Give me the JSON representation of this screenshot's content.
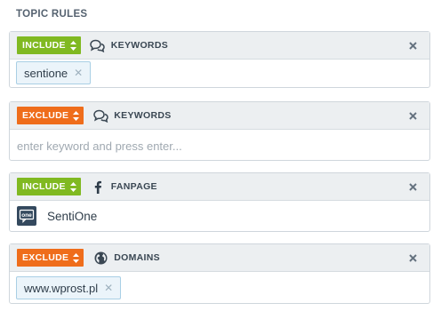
{
  "section_title": "TOPIC RULES",
  "rules": [
    {
      "type_label": "INCLUDE",
      "type": "include",
      "icon": "speech-bubbles-icon",
      "label": "KEYWORDS",
      "tags": [
        "sentione"
      ]
    },
    {
      "type_label": "EXCLUDE",
      "type": "exclude",
      "icon": "speech-bubbles-icon",
      "label": "KEYWORDS",
      "input_placeholder": "enter keyword and press enter..."
    },
    {
      "type_label": "INCLUDE",
      "type": "include",
      "icon": "facebook-icon",
      "label": "FANPAGE",
      "fanpage": {
        "name": "SentiOne",
        "avatar_text": "one"
      }
    },
    {
      "type_label": "EXCLUDE",
      "type": "exclude",
      "icon": "globe-icon",
      "label": "DOMAINS",
      "tags": [
        "www.wprost.pl"
      ]
    }
  ],
  "colors": {
    "include": "#80b921",
    "exclude": "#ef6d1b",
    "tag_bg": "#ebf4fa",
    "header_bg": "#eceff1"
  },
  "close_glyph": "✕",
  "tag_remove_glyph": "✕"
}
